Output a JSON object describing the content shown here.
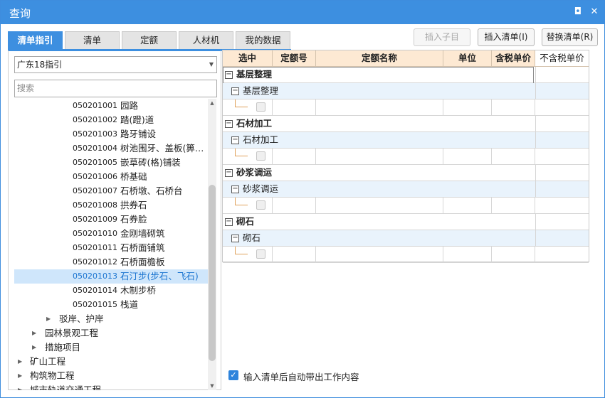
{
  "window": {
    "title": "查询",
    "restore_glyph": "◘",
    "close_glyph": "✕"
  },
  "tabs": [
    {
      "label": "清单指引",
      "active": true
    },
    {
      "label": "清单",
      "active": false
    },
    {
      "label": "定额",
      "active": false
    },
    {
      "label": "人材机",
      "active": false
    },
    {
      "label": "我的数据",
      "active": false
    }
  ],
  "actions": {
    "insert_child": "插入子目",
    "insert_list": "插入清单(I)",
    "replace_list": "替换清单(R)"
  },
  "left": {
    "combo_value": "广东18指引",
    "search_placeholder": "搜索",
    "items": [
      {
        "code": "050201001",
        "name": "园路"
      },
      {
        "code": "050201002",
        "name": "踏(蹬)道"
      },
      {
        "code": "050201003",
        "name": "路牙铺设"
      },
      {
        "code": "050201004",
        "name": "树池围牙、盖板(箅…"
      },
      {
        "code": "050201005",
        "name": "嵌草砖(格)铺装"
      },
      {
        "code": "050201006",
        "name": "桥基础"
      },
      {
        "code": "050201007",
        "name": "石桥墩、石桥台"
      },
      {
        "code": "050201008",
        "name": "拱券石"
      },
      {
        "code": "050201009",
        "name": "石券脸"
      },
      {
        "code": "050201010",
        "name": "金刚墙砌筑"
      },
      {
        "code": "050201011",
        "name": "石桥面铺筑"
      },
      {
        "code": "050201012",
        "name": "石桥面檐板"
      },
      {
        "code": "050201013",
        "name": "石汀步(步石、飞石)"
      },
      {
        "code": "050201014",
        "name": "木制步桥"
      },
      {
        "code": "050201015",
        "name": "栈道"
      }
    ],
    "folders": [
      {
        "label": "驳岸、护岸"
      },
      {
        "label": "园林景观工程"
      },
      {
        "label": "措施项目"
      },
      {
        "label": "矿山工程"
      },
      {
        "label": "构筑物工程"
      },
      {
        "label": "城市轨道交通工程"
      }
    ]
  },
  "grid": {
    "headers": [
      "选中",
      "定额号",
      "定额名称",
      "单位",
      "含税单价",
      "不含税单价"
    ],
    "groups": [
      {
        "title": "基层整理",
        "sub": "基层整理"
      },
      {
        "title": "石材加工",
        "sub": "石材加工"
      },
      {
        "title": "砂浆调运",
        "sub": "砂浆调运"
      },
      {
        "title": "砌石",
        "sub": "砌石"
      }
    ]
  },
  "footer": {
    "auto_output_label": "输入清单后自动带出工作内容",
    "checked": true
  },
  "colors": {
    "accent": "#3d8fe0",
    "header_bg": "#fde9d3",
    "selected_bg": "#cfe6fb",
    "sub_row_bg": "#e9f3fc"
  }
}
